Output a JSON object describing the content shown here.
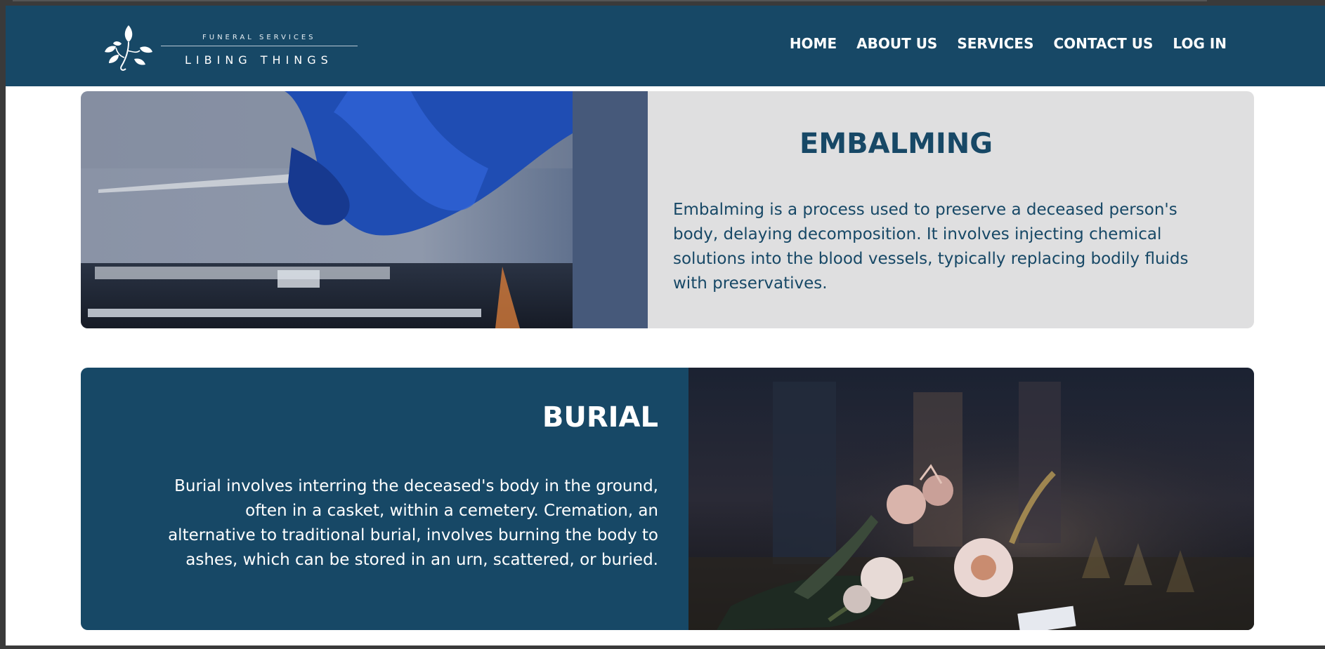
{
  "brand": {
    "tagline": "FUNERAL SERVICES",
    "name": "LIBING THINGS"
  },
  "nav": {
    "items": [
      "HOME",
      "ABOUT US",
      "SERVICES",
      "CONTACT US",
      "LOG IN"
    ]
  },
  "services": [
    {
      "title": "EMBALMING",
      "description": "Embalming is a process used to preserve a deceased person's body, delaying decomposition. It involves injecting chemical solutions into the blood vessels, typically replacing bodily fluids with preservatives."
    },
    {
      "title": "BURIAL",
      "description": "Burial involves interring the deceased's body in the ground, often in a casket, within a cemetery. Cremation, an alternative to traditional burial, involves burning the body to ashes, which can be stored in an urn, scattered, or buried."
    }
  ],
  "colors": {
    "primary": "#174866",
    "card_light": "#dfdfe0",
    "text_light": "#ffffff"
  }
}
